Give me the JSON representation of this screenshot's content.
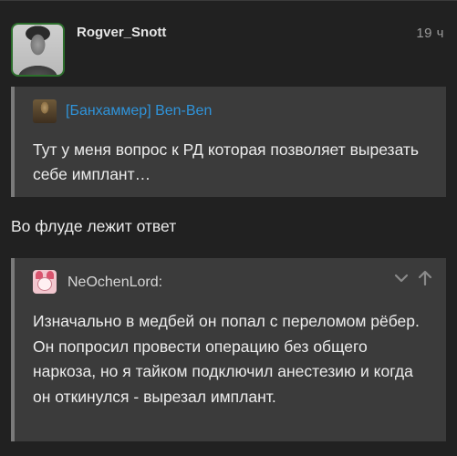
{
  "post": {
    "author": "Rogver_Snott",
    "time": "19 ч",
    "reply_text": "Во флуде лежит ответ"
  },
  "quotes": [
    {
      "author": "[Банхаммер] Ben-Ben",
      "text": "Тут у меня вопрос к РД которая позволяет вырезать себе имплант…"
    },
    {
      "author": "NeOchenLord:",
      "text": "Изначально в медбей он попал с переломом рёбер. Он попросил провести операцию без общего наркоза, но я тайком подключил анестезию и когда он откинулся - вырезал имплант."
    }
  ],
  "icons": {
    "collapse": "chevron-down-icon",
    "up": "arrow-up-icon"
  },
  "colors": {
    "background": "#212121",
    "quote_background": "#3b3b3b",
    "link": "#2f93d9",
    "avatar_border": "#2c6e2c"
  }
}
